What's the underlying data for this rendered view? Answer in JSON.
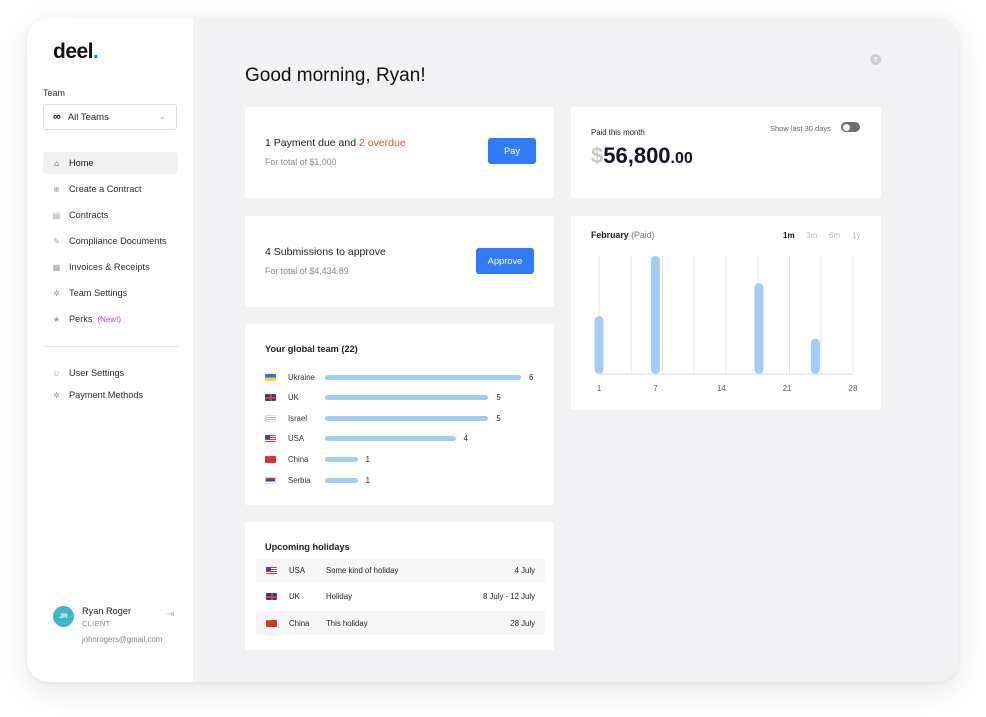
{
  "sidebar": {
    "logo": "deel",
    "logo_dot": ".",
    "team_label": "Team",
    "team_select": "All Teams",
    "nav": [
      {
        "label": "Home",
        "icon": "home-icon"
      },
      {
        "label": "Create a Contract",
        "icon": "plus-circle-icon"
      },
      {
        "label": "Contracts",
        "icon": "document-icon"
      },
      {
        "label": "Compliance Documents",
        "icon": "pen-icon"
      },
      {
        "label": "Invoices & Receipts",
        "icon": "receipt-icon"
      },
      {
        "label": "Team Settings",
        "icon": "gear-icon"
      },
      {
        "label": "Perks",
        "icon": "star-icon",
        "badge": "(New!)"
      }
    ],
    "nav2": [
      {
        "label": "User Settings",
        "icon": "user-icon"
      },
      {
        "label": "Payment Methods",
        "icon": "gear-icon"
      }
    ],
    "user": {
      "initials": "JR",
      "name": "Ryan Roger",
      "role": "CLIENT",
      "email": "johnrogers@gmail.com"
    }
  },
  "main": {
    "greeting": "Good morning, Ryan!",
    "help": "?",
    "payment": {
      "text_prefix": "1 Payment due and ",
      "overdue": "2 overdue",
      "sub": "For total of $1,000",
      "button": "Pay"
    },
    "approve": {
      "text": "4 Submissions to approve",
      "sub": "For total of $4,434.89",
      "button": "Approve"
    },
    "paid": {
      "label": "Paid this month",
      "currency": "$",
      "amount": "56,800",
      "cents": ".00",
      "toggle_label": "Show last 30 days"
    },
    "global_team": {
      "title": "Your global team (22)",
      "rows": [
        {
          "country": "Ukraine",
          "count": 6,
          "flag": "ua"
        },
        {
          "country": "UK",
          "count": 5,
          "flag": "uk"
        },
        {
          "country": "Israel",
          "count": 5,
          "flag": "il"
        },
        {
          "country": "USA",
          "count": 4,
          "flag": "us"
        },
        {
          "country": "China",
          "count": 1,
          "flag": "cn"
        },
        {
          "country": "Serbia",
          "count": 1,
          "flag": "rs"
        }
      ]
    },
    "holidays": {
      "title": "Upcoming holidays",
      "rows": [
        {
          "country": "USA",
          "name": "Some kind of holiday",
          "date": "4 July",
          "flag": "us"
        },
        {
          "country": "UK",
          "name": "Holiday",
          "date": "8 July - 12 July",
          "flag": "uk"
        },
        {
          "country": "China",
          "name": "This holiday",
          "date": "28 July",
          "flag": "cn"
        }
      ]
    },
    "chart_card": {
      "title": "February",
      "title_suffix": "(Paid)",
      "ranges": [
        "1m",
        "3m",
        "6m",
        "1y"
      ],
      "selected_range": "1m"
    }
  },
  "chart_data": {
    "type": "bar",
    "title": "February (Paid)",
    "x_ticks": [
      1,
      7,
      14,
      21,
      28
    ],
    "x_range": [
      1,
      28
    ],
    "points": [
      {
        "x": 1,
        "y": 0.49
      },
      {
        "x": 7,
        "y": 1.0
      },
      {
        "x": 18,
        "y": 0.77
      },
      {
        "x": 24,
        "y": 0.3
      }
    ],
    "bar_color": "#a3ccf4",
    "grid": true
  },
  "colors": {
    "accent": "#2f7cf6",
    "overdue": "#e4553b",
    "logo_dot": "#1b8de0",
    "bar": "#a3ccf4",
    "perks_badge": "#a94fd0"
  }
}
